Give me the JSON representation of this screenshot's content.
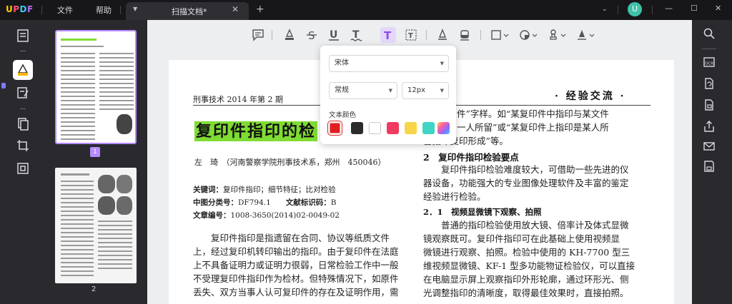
{
  "app": {
    "logo": {
      "u": "U",
      "p": "P",
      "d": "D",
      "f": "F"
    },
    "menu": {
      "file": "文件",
      "help": "帮助"
    },
    "tab": {
      "name": "扫描文档*"
    },
    "user_initial": "U"
  },
  "thumbnails": {
    "page1_number": "1",
    "page2_number": "2"
  },
  "toolbar": {
    "icons": [
      "comment-icon",
      "highlight-icon",
      "strikethrough-icon",
      "underline-icon",
      "squiggly-underline-icon",
      "text-comment-icon",
      "text-box-icon",
      "pencil-icon",
      "eraser-icon",
      "shape-icon",
      "sticker-icon",
      "stamp-icon",
      "signature-icon"
    ]
  },
  "font_popover": {
    "font_family": "宋体",
    "font_style": "常规",
    "font_size": "12px",
    "color_label": "文本颜色",
    "colors": [
      "#e02020",
      "#2b2b2b",
      "#ffffff",
      "#f03a5f",
      "#f8d548",
      "#40d4c6",
      "gradient"
    ]
  },
  "document": {
    "header_left": "刑事技术 2014 年第 2 期",
    "header_right": "· 经验交流 ·",
    "title": "复印件指印的检",
    "author": "左　琦　（河南警察学院刑事技术系，郑州　450046）",
    "keywords_label": "关键词：",
    "keywords": "复印件指印；细节特征；比对检验",
    "clc_label": "中图分类号：",
    "clc": "DF794.1",
    "doc_code_label": "文献标识码：",
    "doc_code": "B",
    "article_no_label": "文章编号：",
    "article_no": "1008-3650(2014)02-0049-02",
    "left_body": [
      "　　复印件指印是指遗留在合同、协议等纸质文件",
      "上，经过复印机转印输出的指印。由于复印件在法庭",
      "上不具备证明力或证明力很弱，日常检验工作中一般",
      "不受理复印件指印作为检材。但特殊情况下，如原件",
      "丢失、双方当事人认可复印件的存在及证明作用，需"
    ],
    "right_top": [
      "复印件”字样。如“某复印件中指印与某文件",
      "是同一人所留”或“某复印件上指印是某人所",
      "留指印复印形成”等。"
    ],
    "section2_title": "2　复印件指印检验要点",
    "section2_body": [
      "　　复印件指印检验难度较大，可借助一些先进的仪",
      "器设备，功能强大的专业图像处理软件及丰富的鉴定",
      "经验进行检验。"
    ],
    "section21_title": "2．1　视频显微镜下观察、拍照",
    "section21_body": [
      "　　普通的指印检验使用放大镜、倍率计及体式显微",
      "镜观察既可。复印件指印可在此基础上使用视频显",
      "微镜进行观察、拍照。检验中使用的 KH-7700 型三",
      "维视频显微镜、KF-1 型多功能物证检验仪，可以直接",
      "在电脑显示屏上观察指印外形轮廓，通过环形光、侧",
      "光调整指印的清晰度，取得最佳效果时，直接拍照。"
    ]
  }
}
